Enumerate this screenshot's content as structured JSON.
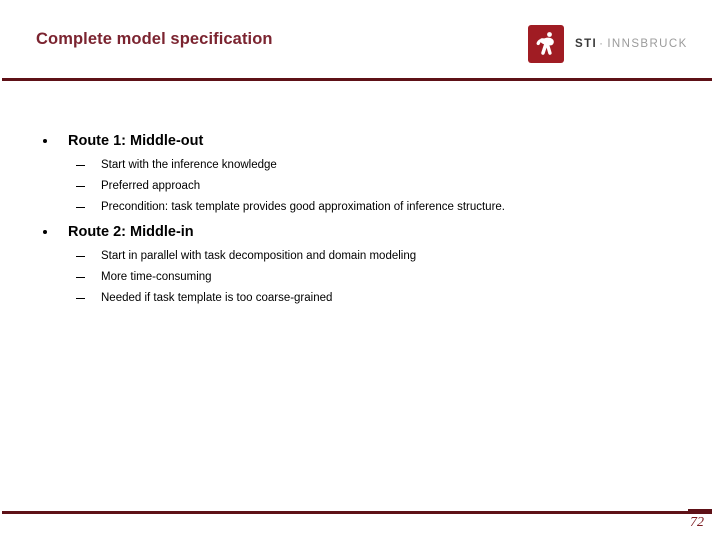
{
  "slide": {
    "title": "Complete model specification",
    "page_number": "72",
    "accent_color": "#5E1117",
    "title_color": "#7B2430",
    "logo_color": "#A01C23"
  },
  "logo": {
    "mark_icon": "sti-figure-icon",
    "brand": "STI",
    "separator": "·",
    "location": "INNSBRUCK"
  },
  "body": {
    "groups": [
      {
        "heading": "Route 1: Middle-out",
        "items": [
          "Start with the inference knowledge",
          "Preferred approach",
          "Precondition: task template provides good approximation of inference structure."
        ]
      },
      {
        "heading": "Route 2: Middle-in",
        "items": [
          "Start in parallel with task decomposition and domain modeling",
          "More time-consuming",
          "Needed if task template is too coarse-grained"
        ]
      }
    ]
  }
}
